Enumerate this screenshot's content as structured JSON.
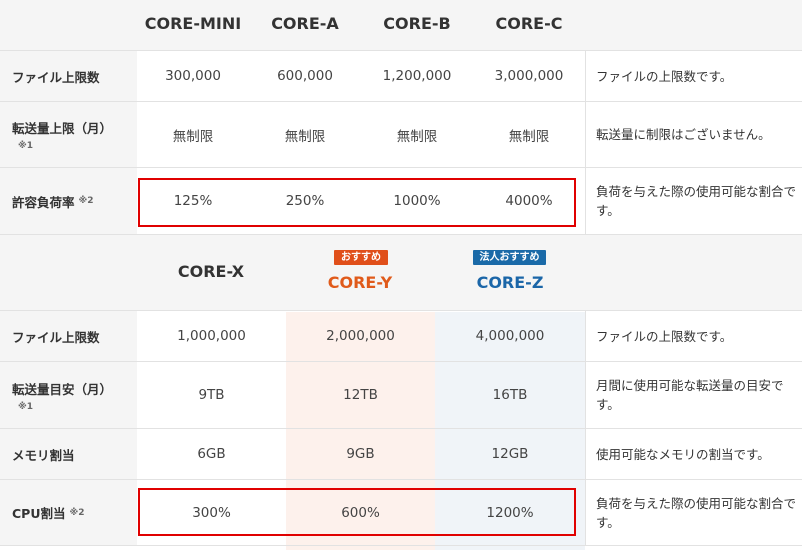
{
  "section1": {
    "plans": [
      "CORE-MINI",
      "CORE-A",
      "CORE-B",
      "CORE-C"
    ],
    "rows": [
      {
        "label": "ファイル上限数",
        "note": "",
        "values": [
          "300,000",
          "600,000",
          "1,200,000",
          "3,000,000"
        ],
        "desc": "ファイルの上限数です。"
      },
      {
        "label": "転送量上限（月）",
        "note": "※1",
        "values": [
          "無制限",
          "無制限",
          "無制限",
          "無制限"
        ],
        "desc": "転送量に制限はございません。"
      },
      {
        "label": "許容負荷率",
        "note": "※2",
        "values": [
          "125%",
          "250%",
          "1000%",
          "4000%"
        ],
        "desc": "負荷を与えた際の使用可能な割合です。"
      }
    ]
  },
  "section2": {
    "plans": [
      {
        "name": "CORE-X",
        "badge": ""
      },
      {
        "name": "CORE-Y",
        "badge": "おすすめ"
      },
      {
        "name": "CORE-Z",
        "badge": "法人おすすめ"
      }
    ],
    "rows": [
      {
        "label": "ファイル上限数",
        "note": "",
        "values": [
          "1,000,000",
          "2,000,000",
          "4,000,000"
        ],
        "desc": "ファイルの上限数です。"
      },
      {
        "label": "転送量目安（月）",
        "note": "※1",
        "values": [
          "9TB",
          "12TB",
          "16TB"
        ],
        "desc": "月間に使用可能な転送量の目安です。"
      },
      {
        "label": "メモリ割当",
        "note": "",
        "values": [
          "6GB",
          "9GB",
          "12GB"
        ],
        "desc": "使用可能なメモリの割当です。"
      },
      {
        "label": "CPU割当",
        "note": "※2",
        "values": [
          "300%",
          "600%",
          "1200%"
        ],
        "desc": "負荷を与えた際の使用可能な割合です。"
      }
    ]
  },
  "colors": {
    "highlight_border": "#e00000",
    "recommended": "#e05a1a",
    "corporate": "#1b66a8"
  }
}
